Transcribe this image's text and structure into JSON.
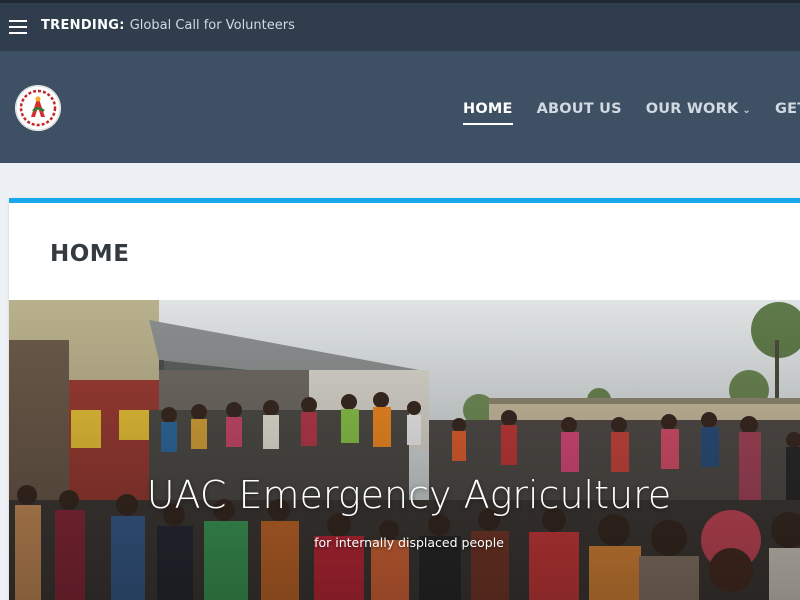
{
  "topbar": {
    "menu_icon": "hamburger-menu-icon",
    "trending_label": "TRENDING:",
    "trending_text": "Global Call for Volunteers"
  },
  "header": {
    "logo_icon": "organization-logo",
    "nav": [
      {
        "label": "HOME",
        "active": true
      },
      {
        "label": "ABOUT US"
      },
      {
        "label": "OUR WORK",
        "icon": "chevron-down-icon"
      },
      {
        "label": "GET IN"
      }
    ]
  },
  "page": {
    "title": "HOME",
    "hero": {
      "title": "UAC Emergency Agriculture",
      "subtitle": "for internally displaced people"
    }
  },
  "colors": {
    "topbar": "#2f3d4d",
    "navbar": "#3e5063",
    "accent": "#1aa7ec",
    "page_bg": "#edf0f4"
  }
}
